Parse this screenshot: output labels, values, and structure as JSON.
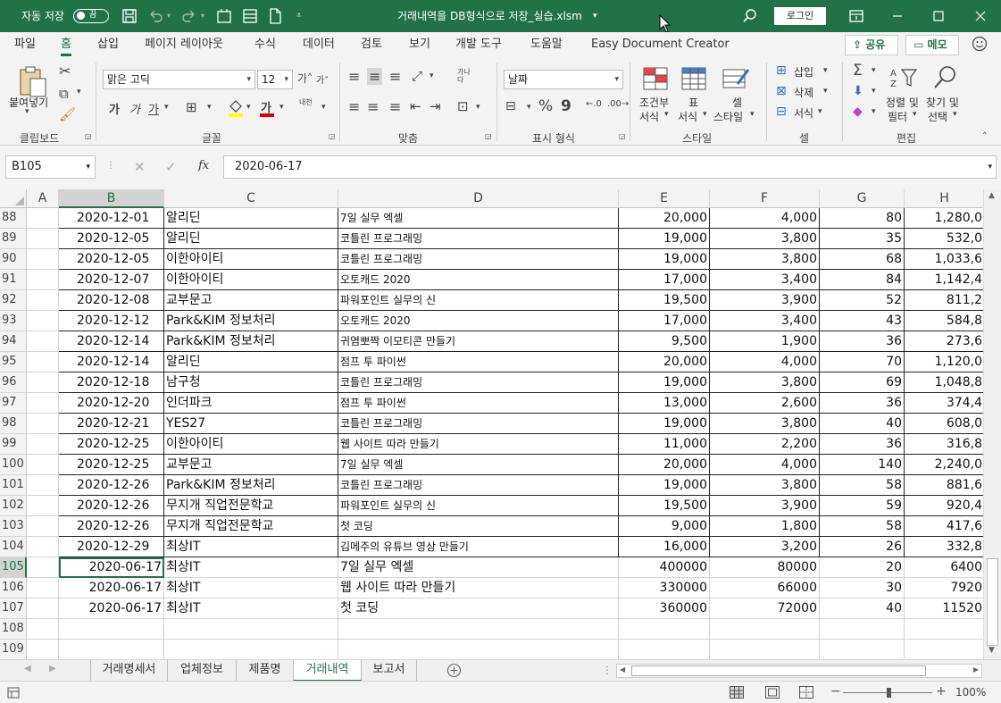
{
  "titlebar": {
    "autosave_label": "자동 저장",
    "autosave_state": "끔",
    "document_title": "거래내역을 DB형식으로 저장_실습.xlsm",
    "title_caret": "▾",
    "login_label": "로그인"
  },
  "ribbon_tabs": [
    "파일",
    "홈",
    "삽입",
    "페이지 레이아웃",
    "수식",
    "데이터",
    "검토",
    "보기",
    "개발 도구",
    "도움말",
    "Easy Document Creator"
  ],
  "share_label": "공유",
  "memo_label": "메모",
  "ribbon": {
    "clipboard": {
      "paste": "붙여넣기",
      "group": "클립보드"
    },
    "font": {
      "family": "맑은 고딕",
      "size": "12",
      "bold": "가",
      "italic": "가",
      "underline": "가",
      "font_color": "가",
      "phonetic": "내천",
      "group": "글꼴"
    },
    "alignment": {
      "wrap": "가나다",
      "group": "맞춤"
    },
    "number": {
      "format": "날짜",
      "percent": "%",
      "comma": "9",
      "group": "표시 형식"
    },
    "styles": {
      "conditional": [
        "조건부",
        "서식"
      ],
      "table": [
        "표",
        "서식"
      ],
      "cell": [
        "셀",
        "스타일"
      ],
      "group": "스타일"
    },
    "cells": {
      "insert": "삽입",
      "delete": "삭제",
      "format": "서식",
      "group": "셀"
    },
    "editing": {
      "sort": [
        "정렬 및",
        "필터"
      ],
      "find": [
        "찾기 및",
        "선택"
      ],
      "group": "편집"
    }
  },
  "formula_bar": {
    "name_box": "B105",
    "value": "2020-06-17"
  },
  "columns": [
    "A",
    "B",
    "C",
    "D",
    "E",
    "F",
    "G",
    "H"
  ],
  "selected_column": "B",
  "selected_row": "105",
  "rows": [
    {
      "num": "88",
      "b": "2020-12-01",
      "c": "알리딘",
      "d": "7일 실무 엑셀",
      "e": "20,000",
      "f": "4,000",
      "g": "80",
      "h": "1,280,0"
    },
    {
      "num": "89",
      "b": "2020-12-05",
      "c": "알리딘",
      "d": "코틀린 프로그래밍",
      "e": "19,000",
      "f": "3,800",
      "g": "35",
      "h": "532,0"
    },
    {
      "num": "90",
      "b": "2020-12-05",
      "c": "이한아이티",
      "d": "코틀린 프로그래밍",
      "e": "19,000",
      "f": "3,800",
      "g": "68",
      "h": "1,033,6"
    },
    {
      "num": "91",
      "b": "2020-12-07",
      "c": "이한아이티",
      "d": "오토캐드 2020",
      "e": "17,000",
      "f": "3,400",
      "g": "84",
      "h": "1,142,4"
    },
    {
      "num": "92",
      "b": "2020-12-08",
      "c": "교부문고",
      "d": "파워포인트 실무의 신",
      "e": "19,500",
      "f": "3,900",
      "g": "52",
      "h": "811,2"
    },
    {
      "num": "93",
      "b": "2020-12-12",
      "c": "Park&KIM 정보처리",
      "d": "오토캐드 2020",
      "e": "17,000",
      "f": "3,400",
      "g": "43",
      "h": "584,8"
    },
    {
      "num": "94",
      "b": "2020-12-14",
      "c": "Park&KIM 정보처리",
      "d": "귀염뽀짝 이모티콘 만들기",
      "e": "9,500",
      "f": "1,900",
      "g": "36",
      "h": "273,6"
    },
    {
      "num": "95",
      "b": "2020-12-14",
      "c": "알리딘",
      "d": "점프 투 파이썬",
      "e": "20,000",
      "f": "4,000",
      "g": "70",
      "h": "1,120,0"
    },
    {
      "num": "96",
      "b": "2020-12-18",
      "c": "남구청",
      "d": "코틀린 프로그래밍",
      "e": "19,000",
      "f": "3,800",
      "g": "69",
      "h": "1,048,8"
    },
    {
      "num": "97",
      "b": "2020-12-20",
      "c": "인더파크",
      "d": "점프 투 파이썬",
      "e": "13,000",
      "f": "2,600",
      "g": "36",
      "h": "374,4"
    },
    {
      "num": "98",
      "b": "2020-12-21",
      "c": "YES27",
      "d": "코틀린 프로그래밍",
      "e": "19,000",
      "f": "3,800",
      "g": "40",
      "h": "608,0"
    },
    {
      "num": "99",
      "b": "2020-12-25",
      "c": "이한아이티",
      "d": "웹 사이트 따라 만들기",
      "e": "11,000",
      "f": "2,200",
      "g": "36",
      "h": "316,8"
    },
    {
      "num": "100",
      "b": "2020-12-25",
      "c": "교부문고",
      "d": "7일 실무 엑셀",
      "e": "20,000",
      "f": "4,000",
      "g": "140",
      "h": "2,240,0"
    },
    {
      "num": "101",
      "b": "2020-12-26",
      "c": "Park&KIM 정보처리",
      "d": "코틀린 프로그래밍",
      "e": "19,000",
      "f": "3,800",
      "g": "58",
      "h": "881,6"
    },
    {
      "num": "102",
      "b": "2020-12-26",
      "c": "무지개 직업전문학교",
      "d": "파워포인트 실무의 신",
      "e": "19,500",
      "f": "3,900",
      "g": "59",
      "h": "920,4"
    },
    {
      "num": "103",
      "b": "2020-12-26",
      "c": "무지개 직업전문학교",
      "d": "첫 코딩",
      "e": "9,000",
      "f": "1,800",
      "g": "58",
      "h": "417,6"
    },
    {
      "num": "104",
      "b": "2020-12-29",
      "c": "최상IT",
      "d": "김메주의 유튜브 영상 만들기",
      "e": "16,000",
      "f": "3,200",
      "g": "26",
      "h": "332,8"
    },
    {
      "num": "105",
      "b": "2020-06-17",
      "c": "최상IT",
      "d": "7일 실무 엑셀",
      "e": "400000",
      "f": "80000",
      "g": "20",
      "h": "6400"
    },
    {
      "num": "106",
      "b": "2020-06-17",
      "c": "최상IT",
      "d": "웹 사이트 따라 만들기",
      "e": "330000",
      "f": "66000",
      "g": "30",
      "h": "7920"
    },
    {
      "num": "107",
      "b": "2020-06-17",
      "c": "최상IT",
      "d": "첫 코딩",
      "e": "360000",
      "f": "72000",
      "g": "40",
      "h": "11520"
    },
    {
      "num": "108",
      "b": "",
      "c": "",
      "d": "",
      "e": "",
      "f": "",
      "g": "",
      "h": ""
    },
    {
      "num": "109",
      "b": "",
      "c": "",
      "d": "",
      "e": "",
      "f": "",
      "g": "",
      "h": ""
    }
  ],
  "sheet_tabs": [
    "거래명세서",
    "업체정보",
    "제품명",
    "거래내역",
    "보고서"
  ],
  "active_sheet": "거래내역",
  "status": {
    "zoom": "100%"
  },
  "colors": {
    "accent": "#217346"
  }
}
